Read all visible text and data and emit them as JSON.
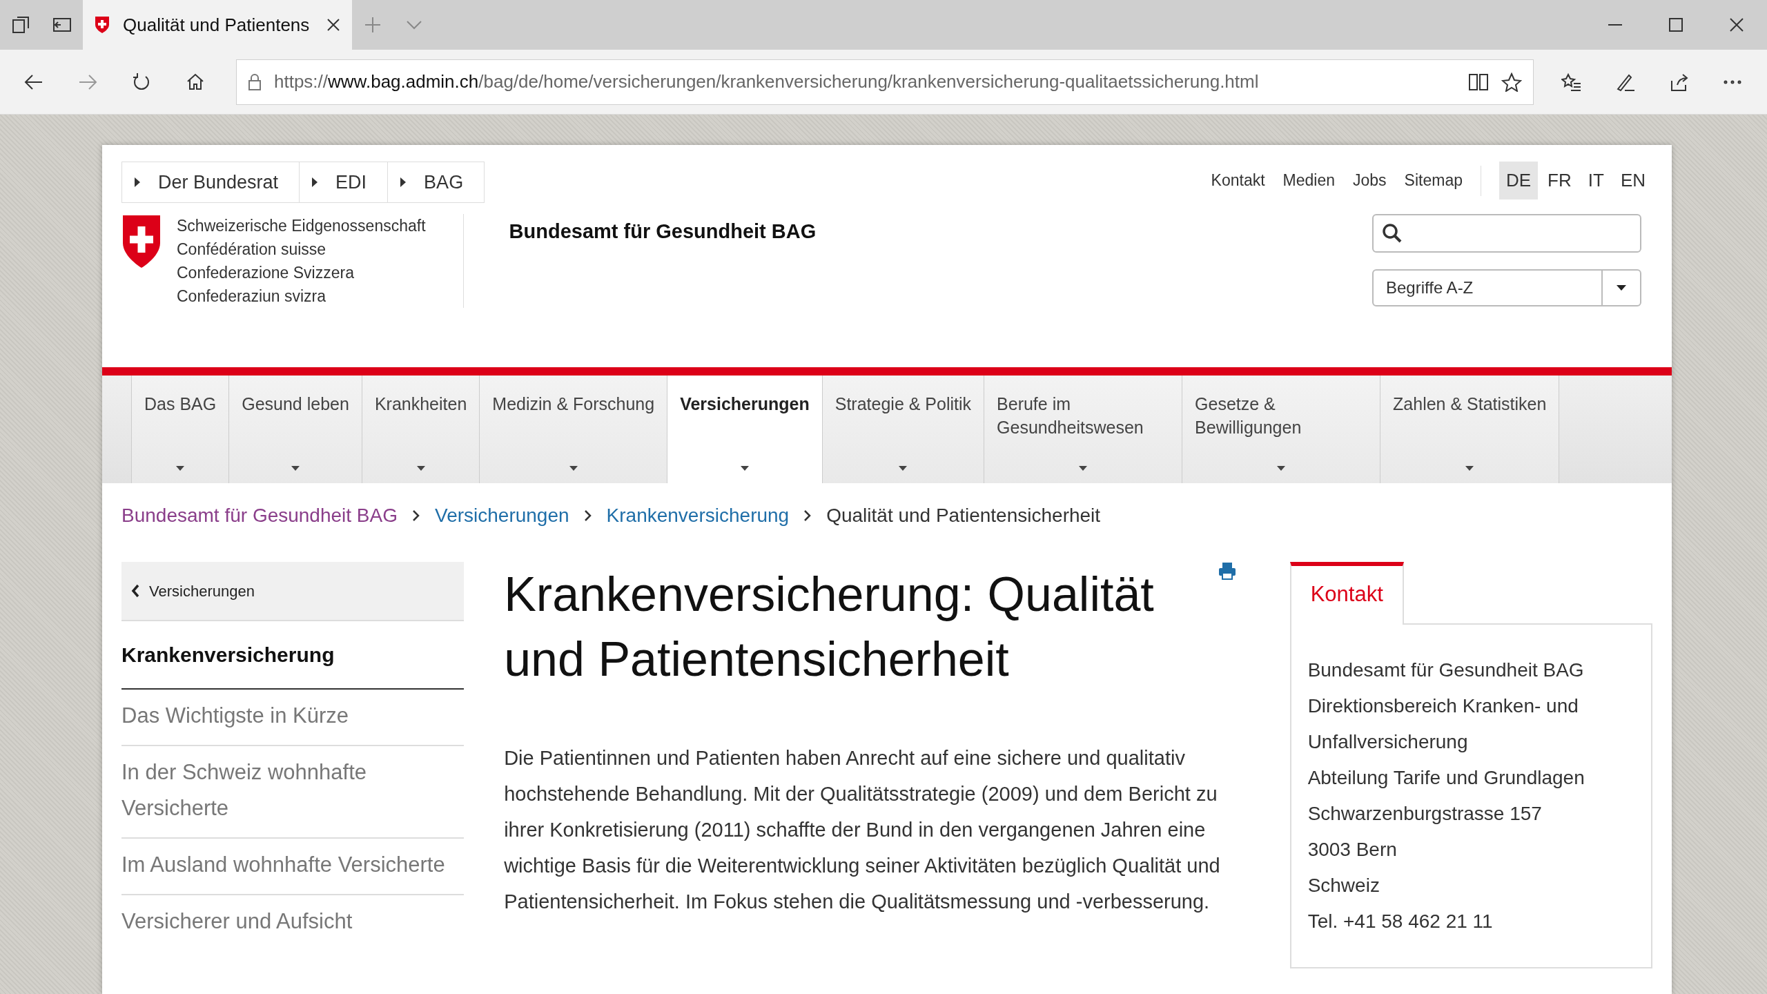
{
  "browser": {
    "tab_title": "Qualität und Patientens",
    "url_scheme": "https://",
    "url_domain": "www.bag.admin.ch",
    "url_path": "/bag/de/home/versicherungen/krankenversicherung/krankenversicherung-qualitaetssicherung.html"
  },
  "top_breadcrumb": [
    "Der Bundesrat",
    "EDI",
    "BAG"
  ],
  "service_links": [
    "Kontakt",
    "Medien",
    "Jobs",
    "Sitemap"
  ],
  "languages": [
    {
      "label": "DE",
      "selected": true
    },
    {
      "label": "FR",
      "selected": false
    },
    {
      "label": "IT",
      "selected": false
    },
    {
      "label": "EN",
      "selected": false
    }
  ],
  "logo_lines": [
    "Schweizerische Eidgenossenschaft",
    "Confédération suisse",
    "Confederazione Svizzera",
    "Confederaziun svizra"
  ],
  "office_title": "Bundesamt für Gesundheit BAG",
  "glossary_select": {
    "value": "Begriffe A-Z"
  },
  "main_nav": [
    {
      "label": "Das BAG",
      "selected": false
    },
    {
      "label": "Gesund leben",
      "selected": false
    },
    {
      "label": "Krankheiten",
      "selected": false
    },
    {
      "label": "Medizin & Forschung",
      "selected": false
    },
    {
      "label": "Versicherungen",
      "selected": true
    },
    {
      "label": "Strategie & Politik",
      "selected": false
    },
    {
      "label": "Berufe im Gesundheitswesen",
      "selected": false
    },
    {
      "label": "Gesetze & Bewilligungen",
      "selected": false
    },
    {
      "label": "Zahlen & Statistiken",
      "selected": false
    }
  ],
  "breadcrumb": [
    {
      "label": "Bundesamt für Gesundheit BAG",
      "kind": "visited"
    },
    {
      "label": "Versicherungen",
      "kind": "link"
    },
    {
      "label": "Krankenversicherung",
      "kind": "link"
    },
    {
      "label": "Qualität und Patientensicherheit",
      "kind": "current"
    }
  ],
  "sidebar": {
    "back": "Versicherungen",
    "current": "Krankenversicherung",
    "items": [
      "Das Wichtigste in Kürze",
      "In der Schweiz wohnhafte Versicherte",
      "Im Ausland wohnhafte Versicherte",
      "Versicherer und Aufsicht"
    ]
  },
  "article": {
    "title": "Krankenversicherung: Qualität und Patientensicherheit",
    "intro": "Die Patientinnen und Patienten haben Anrecht auf eine sichere und qualitativ hochstehende Behandlung. Mit der Qualitätsstrategie (2009) und dem Bericht zu ihrer Konkretisierung (2011) schaffte der Bund in den vergangenen Jahren eine wichtige Basis für die Weiterentwicklung seiner Aktivitäten bezüglich Qualität und Patientensicherheit. Im Fokus stehen die Qualitätsmessung und -verbesserung."
  },
  "contact": {
    "tab": "Kontakt",
    "lines": [
      "Bundesamt für Gesundheit BAG",
      "Direktionsbereich Kranken- und Unfallversicherung",
      "Abteilung Tarife und Grundlagen",
      "Schwarzenburgstrasse 157",
      "3003 Bern",
      "Schweiz"
    ],
    "phone_label": "Tel.",
    "phone": "+41 58 462 21 11"
  }
}
